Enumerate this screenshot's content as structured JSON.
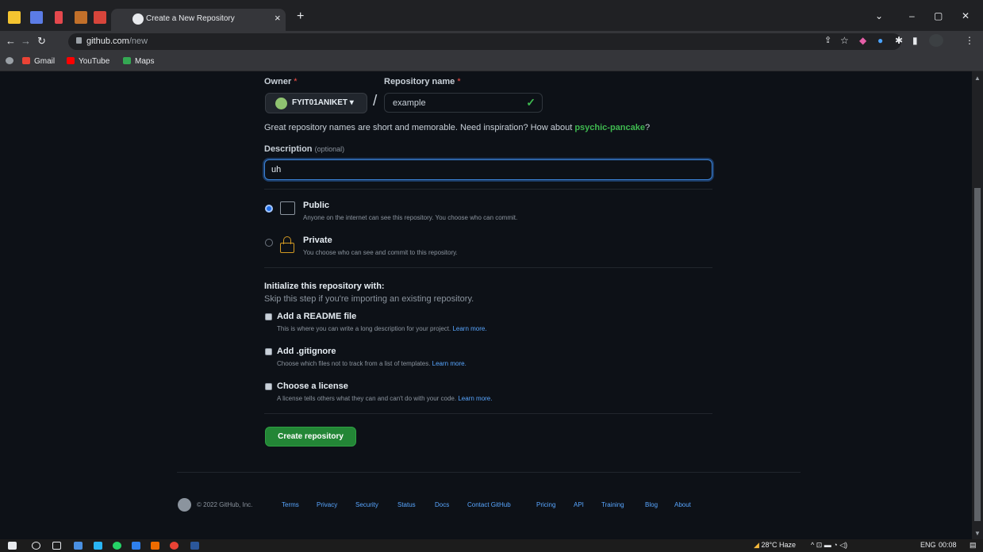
{
  "browser": {
    "tab_title": "Create a New Repository",
    "tab_close": "×",
    "new_tab": "+",
    "url_host": "github.com",
    "url_path": "/new",
    "bookmarks": [
      "Gmail",
      "YouTube",
      "Maps"
    ]
  },
  "form": {
    "owner_label": "Owner",
    "repo_label": "Repository name",
    "required_mark": "*",
    "owner_value": "FYIT01ANIKET",
    "owner_caret": "▾",
    "slash": "/",
    "repo_value": "example",
    "valid_check": "✓",
    "hint_text": "Great repository names are short and memorable. Need inspiration? How about ",
    "suggestion": "psychic-pancake",
    "hint_end": "?",
    "description_label": "Description",
    "description_optional": "(optional)",
    "description_value": "uh"
  },
  "visibility": {
    "selected": "public",
    "public_title": "Public",
    "public_desc": "Anyone on the internet can see this repository. You choose who can commit.",
    "private_title": "Private",
    "private_desc": "You choose who can see and commit to this repository."
  },
  "initialize": {
    "heading": "Initialize this repository with:",
    "sub": "Skip this step if you're importing an existing repository.",
    "options": [
      {
        "title": "Add a README file",
        "desc": "This is where you can write a long description for your project.",
        "link": "Learn more."
      },
      {
        "title": "Add .gitignore",
        "desc": "Choose which files not to track from a list of templates.",
        "link": "Learn more."
      },
      {
        "title": "Choose a license",
        "desc": "A license tells others what they can and can't do with your code.",
        "link": "Learn more."
      }
    ]
  },
  "create_button": "Create repository",
  "footer": {
    "copyright": "© 2022 GitHub, Inc.",
    "links": [
      "Terms",
      "Privacy",
      "Security",
      "Status",
      "Docs",
      "Contact GitHub",
      "Pricing",
      "API",
      "Training",
      "Blog",
      "About"
    ]
  },
  "taskbar": {
    "weather": "28°C Haze",
    "lang": "ENG",
    "time": "00:08"
  },
  "colors": {
    "accent_green": "#238636",
    "link_blue": "#58a6ff",
    "page_bg": "#0d1117"
  }
}
